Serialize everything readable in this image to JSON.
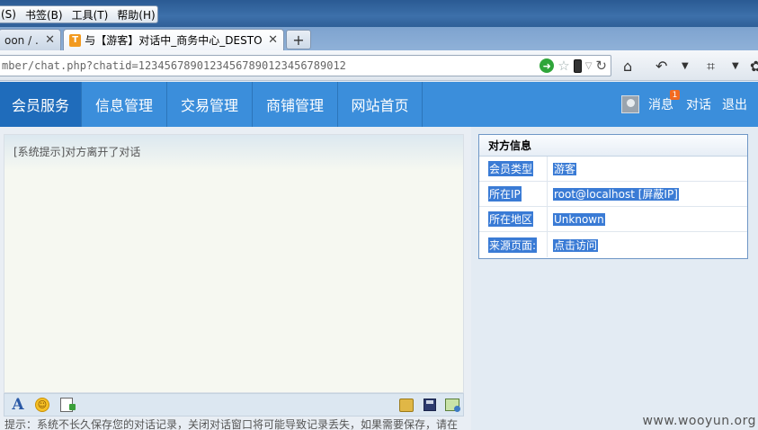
{
  "browser": {
    "menu": [
      "(S)",
      "书签(B)",
      "工具(T)",
      "帮助(H)"
    ],
    "tabs": [
      {
        "title": "oon / ...",
        "active": false
      },
      {
        "title": "与【游客】对话中_商务中心_DESTO...",
        "active": true
      }
    ],
    "new_tab_label": "+",
    "url": "mber/chat.php?chatid=12345678901234567890123456789012"
  },
  "site": {
    "nav": [
      "会员服务",
      "信息管理",
      "交易管理",
      "商铺管理",
      "网站首页"
    ],
    "messages_label": "消息",
    "messages_count": "1",
    "chat_label": "对话",
    "logout_label": "退出"
  },
  "chat": {
    "system_message": "[系统提示]对方离开了对话",
    "hint": "提示：系统不长久保存您的对话记录，关闭对话窗口将可能导致记录丢失，如果需要保存，请在"
  },
  "info_panel": {
    "title": "对方信息",
    "rows": [
      {
        "label": "会员类型",
        "value": "游客"
      },
      {
        "label": "所在IP",
        "value": "root@localhost [屏蔽IP]"
      },
      {
        "label": "所在地区",
        "value": "Unknown"
      },
      {
        "label": "来源页面:",
        "value": "点击访问"
      }
    ]
  },
  "watermark": "www.wooyun.org",
  "colors": {
    "header_bg": "#3b8edb",
    "header_active": "#1f6cbb",
    "selection": "#3a7bd5"
  }
}
